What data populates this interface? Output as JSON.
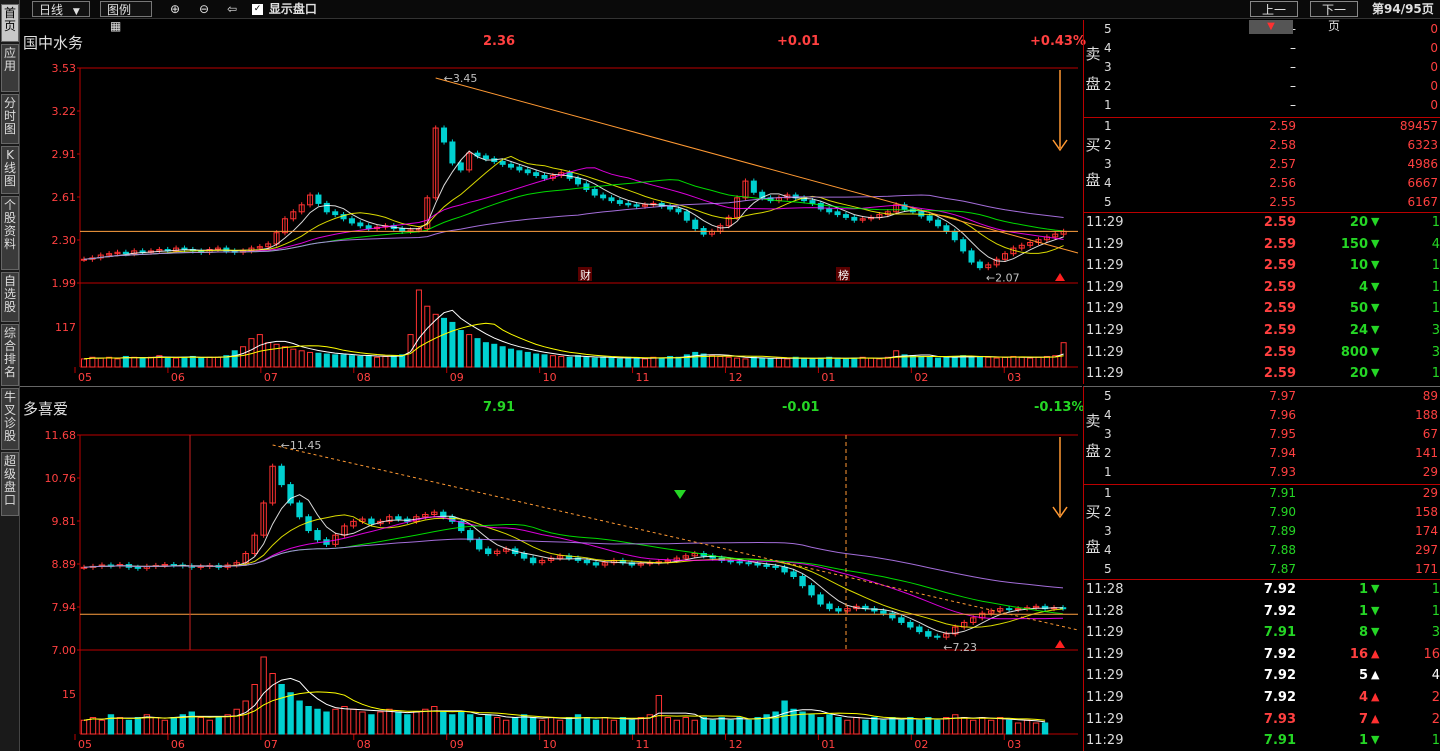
{
  "sidebar": {
    "tabs": [
      "首页",
      "应用",
      "分时图",
      "K线图",
      "个股资料",
      "自选股",
      "综合排名",
      "牛叉诊股",
      "超级盘口"
    ]
  },
  "toolbar": {
    "period": "日线",
    "legend": "图例",
    "show_panel": "显示盘口",
    "prev_page": "上一页",
    "next_page": "下一页",
    "page_info": "第94/95页"
  },
  "chart_data": [
    {
      "type": "candlestick",
      "title": "国中水务",
      "price": "2.36",
      "change": "+0.01",
      "change_pct": "+0.43%",
      "y_ticks": [
        "3.53",
        "3.22",
        "2.91",
        "2.61",
        "2.30",
        "1.99"
      ],
      "ylim": [
        1.99,
        3.53
      ],
      "volume_tick": "117",
      "x_ticks": [
        "05",
        "06",
        "07",
        "08",
        "09",
        "10",
        "11",
        "12",
        "01",
        "02",
        "03"
      ],
      "high_label": "3.45",
      "low_label": "2.07",
      "markers": [
        "财",
        "榜"
      ],
      "closes": [
        2.16,
        2.17,
        2.19,
        2.2,
        2.21,
        2.2,
        2.22,
        2.21,
        2.22,
        2.23,
        2.22,
        2.24,
        2.23,
        2.22,
        2.21,
        2.23,
        2.24,
        2.22,
        2.21,
        2.22,
        2.24,
        2.25,
        2.27,
        2.35,
        2.45,
        2.5,
        2.55,
        2.62,
        2.56,
        2.5,
        2.48,
        2.45,
        2.42,
        2.4,
        2.38,
        2.39,
        2.4,
        2.38,
        2.36,
        2.37,
        2.38,
        2.6,
        3.1,
        3.0,
        2.85,
        2.8,
        2.92,
        2.9,
        2.88,
        2.86,
        2.84,
        2.82,
        2.8,
        2.78,
        2.76,
        2.74,
        2.76,
        2.78,
        2.74,
        2.7,
        2.66,
        2.62,
        2.6,
        2.58,
        2.56,
        2.55,
        2.54,
        2.55,
        2.56,
        2.54,
        2.52,
        2.5,
        2.44,
        2.38,
        2.34,
        2.36,
        2.4,
        2.46,
        2.6,
        2.72,
        2.64,
        2.6,
        2.58,
        2.6,
        2.62,
        2.6,
        2.58,
        2.56,
        2.52,
        2.5,
        2.48,
        2.46,
        2.44,
        2.45,
        2.46,
        2.48,
        2.5,
        2.55,
        2.52,
        2.5,
        2.47,
        2.44,
        2.4,
        2.36,
        2.3,
        2.22,
        2.14,
        2.1,
        2.12,
        2.16,
        2.2,
        2.24,
        2.26,
        2.28,
        2.3,
        2.32,
        2.34,
        2.36
      ],
      "volumes": [
        10,
        12,
        11,
        12,
        10,
        13,
        12,
        11,
        12,
        14,
        12,
        11,
        12,
        13,
        11,
        12,
        12,
        14,
        20,
        25,
        35,
        40,
        30,
        28,
        25,
        22,
        20,
        18,
        17,
        16,
        15,
        15,
        14,
        13,
        14,
        12,
        13,
        14,
        15,
        40,
        95,
        75,
        65,
        60,
        55,
        45,
        40,
        35,
        30,
        28,
        25,
        22,
        20,
        18,
        16,
        15,
        14,
        13,
        12,
        14,
        12,
        11,
        12,
        11,
        10,
        12,
        11,
        10,
        12,
        11,
        13,
        12,
        15,
        18,
        16,
        14,
        13,
        12,
        11,
        10,
        12,
        11,
        10,
        11,
        10,
        12,
        11,
        10,
        11,
        12,
        11,
        10,
        11,
        12,
        11,
        10,
        12,
        20,
        15,
        14,
        13,
        12,
        11,
        12,
        13,
        14,
        12,
        13,
        12,
        11,
        12,
        13,
        12,
        11,
        12,
        13,
        14,
        30
      ]
    },
    {
      "type": "candlestick",
      "title": "多喜爱",
      "price": "7.91",
      "change": "-0.01",
      "change_pct": "-0.13%",
      "y_ticks": [
        "11.68",
        "10.76",
        "9.81",
        "8.89",
        "7.94",
        "7.00"
      ],
      "ylim": [
        7.0,
        11.68
      ],
      "volume_tick": "15",
      "x_ticks": [
        "05",
        "06",
        "07",
        "08",
        "09",
        "10",
        "11",
        "12",
        "01",
        "02",
        "03"
      ],
      "high_label": "11.45",
      "low_label": "7.23",
      "closes": [
        8.8,
        8.82,
        8.85,
        8.83,
        8.86,
        8.8,
        8.78,
        8.82,
        8.84,
        8.86,
        8.85,
        8.83,
        8.8,
        8.82,
        8.84,
        8.8,
        8.85,
        8.9,
        9.1,
        9.5,
        10.2,
        11.0,
        10.6,
        10.2,
        9.9,
        9.6,
        9.4,
        9.3,
        9.5,
        9.7,
        9.8,
        9.85,
        9.75,
        9.8,
        9.9,
        9.85,
        9.8,
        9.9,
        9.95,
        10.0,
        9.9,
        9.8,
        9.6,
        9.4,
        9.2,
        9.1,
        9.15,
        9.2,
        9.1,
        9.0,
        8.9,
        8.95,
        9.0,
        9.05,
        9.0,
        8.95,
        8.9,
        8.85,
        8.9,
        8.95,
        8.9,
        8.85,
        8.88,
        8.9,
        8.92,
        8.95,
        9.0,
        9.05,
        9.1,
        9.05,
        9.0,
        8.95,
        8.92,
        8.9,
        8.88,
        8.85,
        8.82,
        8.8,
        8.7,
        8.6,
        8.4,
        8.2,
        8.0,
        7.9,
        7.85,
        7.9,
        7.95,
        7.9,
        7.85,
        7.8,
        7.7,
        7.6,
        7.5,
        7.4,
        7.3,
        7.28,
        7.35,
        7.5,
        7.6,
        7.7,
        7.8,
        7.85,
        7.9,
        7.88,
        7.9,
        7.92,
        7.95,
        7.9,
        7.92,
        7.91
      ],
      "volumes": [
        5,
        6,
        5,
        7,
        6,
        5,
        6,
        7,
        6,
        5,
        6,
        7,
        8,
        6,
        5,
        6,
        7,
        9,
        12,
        18,
        28,
        22,
        18,
        15,
        12,
        10,
        9,
        8,
        9,
        10,
        9,
        8,
        7,
        8,
        9,
        8,
        7,
        8,
        9,
        10,
        8,
        7,
        8,
        7,
        6,
        7,
        6,
        5,
        6,
        7,
        6,
        5,
        6,
        5,
        6,
        7,
        6,
        5,
        6,
        5,
        6,
        5,
        6,
        7,
        14,
        6,
        5,
        6,
        5,
        6,
        5,
        6,
        5,
        6,
        5,
        6,
        7,
        8,
        12,
        9,
        8,
        7,
        6,
        7,
        6,
        5,
        6,
        5,
        6,
        5,
        6,
        5,
        6,
        5,
        6,
        5,
        6,
        7,
        6,
        5,
        6,
        5,
        6,
        5,
        4,
        5,
        4,
        4
      ]
    }
  ],
  "quote1": {
    "sell_label": [
      "卖",
      "盘"
    ],
    "buy_label": [
      "买",
      "盘"
    ],
    "sell": [
      {
        "level": "5",
        "price": "–",
        "vol": "0"
      },
      {
        "level": "4",
        "price": "–",
        "vol": "0"
      },
      {
        "level": "3",
        "price": "–",
        "vol": "0"
      },
      {
        "level": "2",
        "price": "–",
        "vol": "0"
      },
      {
        "level": "1",
        "price": "–",
        "vol": "0"
      }
    ],
    "buy": [
      {
        "level": "1",
        "price": "2.59",
        "vol": "89457"
      },
      {
        "level": "2",
        "price": "2.58",
        "vol": "6323"
      },
      {
        "level": "3",
        "price": "2.57",
        "vol": "4986"
      },
      {
        "level": "4",
        "price": "2.56",
        "vol": "6667"
      },
      {
        "level": "5",
        "price": "2.55",
        "vol": "6167"
      }
    ],
    "ticks": [
      {
        "time": "11:29",
        "price": "2.59",
        "vol": "20",
        "dir": "down",
        "n": "1"
      },
      {
        "time": "11:29",
        "price": "2.59",
        "vol": "150",
        "dir": "down",
        "n": "4"
      },
      {
        "time": "11:29",
        "price": "2.59",
        "vol": "10",
        "dir": "down",
        "n": "1"
      },
      {
        "time": "11:29",
        "price": "2.59",
        "vol": "4",
        "dir": "down",
        "n": "1"
      },
      {
        "time": "11:29",
        "price": "2.59",
        "vol": "50",
        "dir": "down",
        "n": "1"
      },
      {
        "time": "11:29",
        "price": "2.59",
        "vol": "24",
        "dir": "down",
        "n": "3"
      },
      {
        "time": "11:29",
        "price": "2.59",
        "vol": "800",
        "dir": "down",
        "n": "3"
      },
      {
        "time": "11:29",
        "price": "2.59",
        "vol": "20",
        "dir": "down",
        "n": "1"
      }
    ]
  },
  "quote2": {
    "sell_label": [
      "卖",
      "盘"
    ],
    "buy_label": [
      "买",
      "盘"
    ],
    "sell": [
      {
        "level": "5",
        "price": "7.97",
        "vol": "89"
      },
      {
        "level": "4",
        "price": "7.96",
        "vol": "188"
      },
      {
        "level": "3",
        "price": "7.95",
        "vol": "67"
      },
      {
        "level": "2",
        "price": "7.94",
        "vol": "141"
      },
      {
        "level": "1",
        "price": "7.93",
        "vol": "29"
      }
    ],
    "buy": [
      {
        "level": "1",
        "price": "7.91",
        "vol": "29"
      },
      {
        "level": "2",
        "price": "7.90",
        "vol": "158"
      },
      {
        "level": "3",
        "price": "7.89",
        "vol": "174"
      },
      {
        "level": "4",
        "price": "7.88",
        "vol": "297"
      },
      {
        "level": "5",
        "price": "7.87",
        "vol": "171"
      }
    ],
    "ticks": [
      {
        "time": "11:28",
        "price": "7.92",
        "vol": "1",
        "dir": "down",
        "n": "1",
        "pcolor": "white"
      },
      {
        "time": "11:28",
        "price": "7.92",
        "vol": "1",
        "dir": "down",
        "n": "1",
        "pcolor": "white"
      },
      {
        "time": "11:29",
        "price": "7.91",
        "vol": "8",
        "dir": "down",
        "n": "3",
        "pcolor": "green"
      },
      {
        "time": "11:29",
        "price": "7.92",
        "vol": "16",
        "dir": "up",
        "n": "16",
        "pcolor": "white"
      },
      {
        "time": "11:29",
        "price": "7.92",
        "vol": "5",
        "dir": "neutral",
        "n": "4",
        "pcolor": "white"
      },
      {
        "time": "11:29",
        "price": "7.92",
        "vol": "4",
        "dir": "up",
        "n": "2",
        "pcolor": "white"
      },
      {
        "time": "11:29",
        "price": "7.93",
        "vol": "7",
        "dir": "up",
        "n": "2",
        "pcolor": "red"
      },
      {
        "time": "11:29",
        "price": "7.91",
        "vol": "1",
        "dir": "down",
        "n": "1",
        "pcolor": "green"
      }
    ]
  }
}
